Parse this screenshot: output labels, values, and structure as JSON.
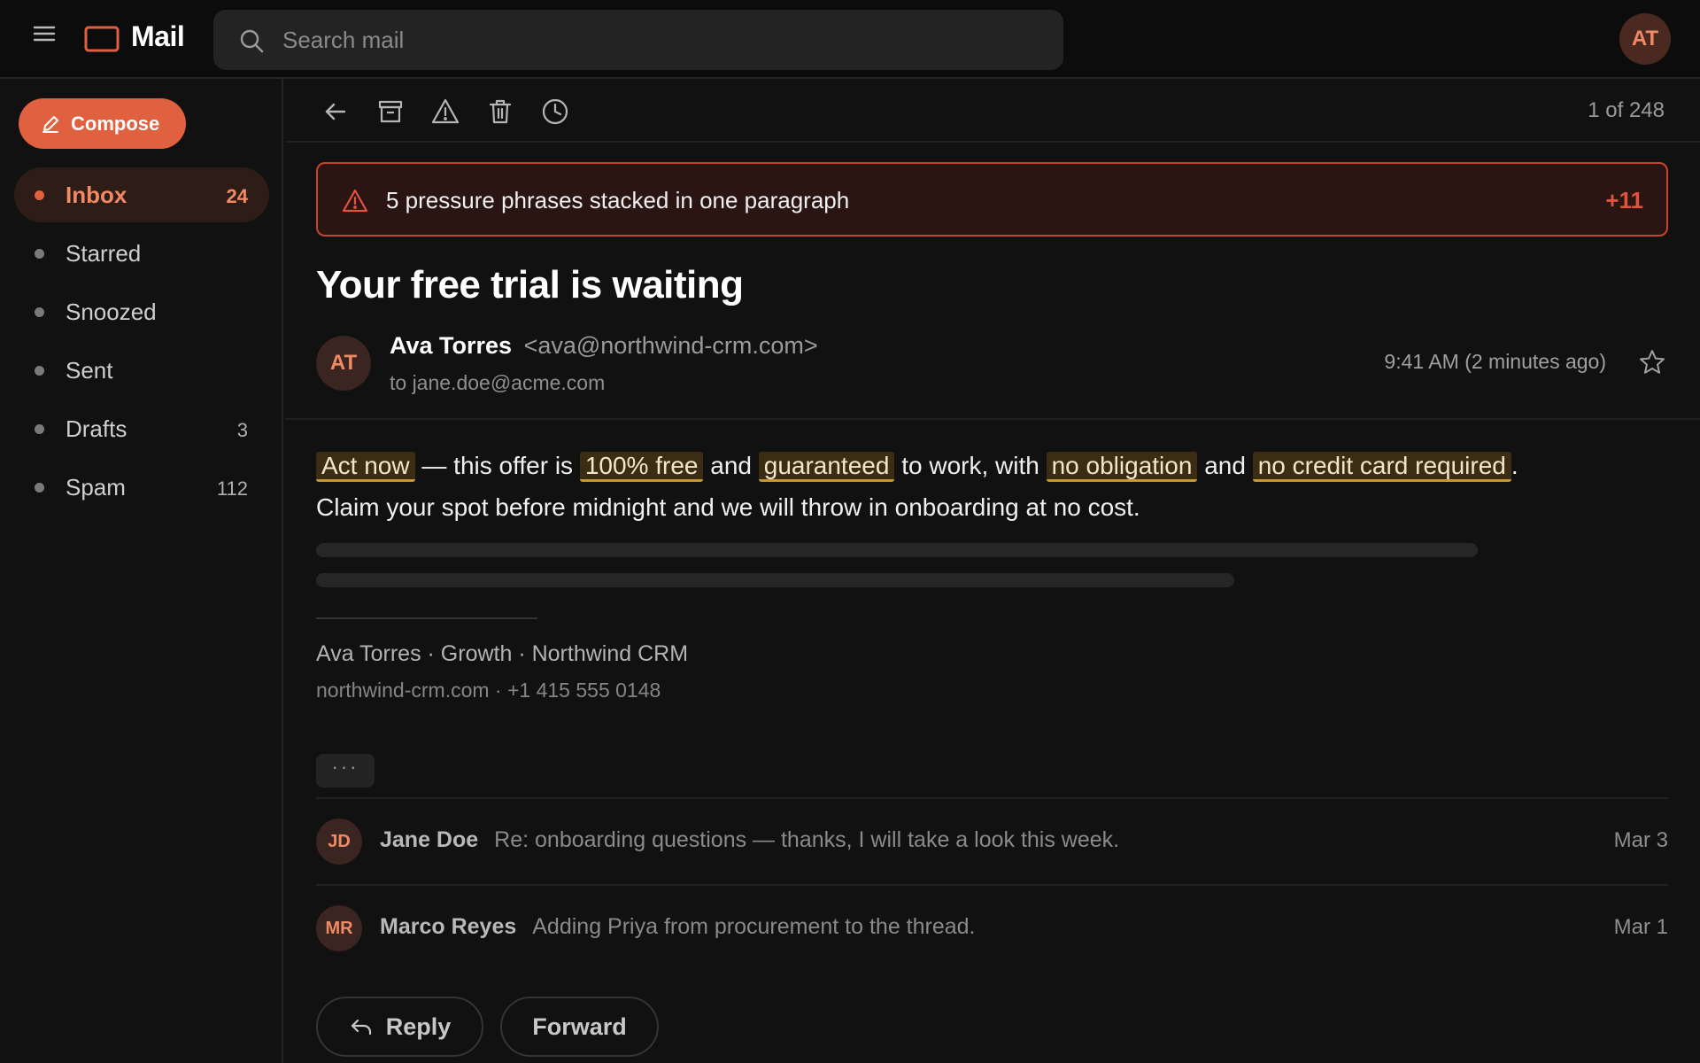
{
  "app": {
    "name": "Mail",
    "accent_color": "#e0613f",
    "user_initials": "AT"
  },
  "search": {
    "placeholder": "Search mail",
    "value": ""
  },
  "sidebar": {
    "compose_label": "Compose",
    "items": [
      {
        "label": "Inbox",
        "count": "24",
        "active": true
      },
      {
        "label": "Starred",
        "count": "",
        "active": false
      },
      {
        "label": "Snoozed",
        "count": "",
        "active": false
      },
      {
        "label": "Sent",
        "count": "",
        "active": false
      },
      {
        "label": "Drafts",
        "count": "3",
        "active": false
      },
      {
        "label": "Spam",
        "count": "112",
        "active": false
      }
    ]
  },
  "toolbar": {
    "icons": [
      "back-arrow-icon",
      "archive-icon",
      "report-spam-icon",
      "delete-icon",
      "snooze-clock-icon"
    ],
    "pager": "1 of 248"
  },
  "alert": {
    "text": "5 pressure phrases stacked in one paragraph",
    "score": "+11",
    "color": "#e0533d"
  },
  "email": {
    "subject": "Your free trial is waiting",
    "sender_initials": "AT",
    "sender_name": "Ava Torres",
    "sender_email": "<ava@northwind-crm.com>",
    "to": "to jane.doe@acme.com",
    "timestamp": "9:41 AM (2 minutes ago)",
    "body": {
      "p1": "Act now",
      "p2": " — this offer is ",
      "p3": "100% free",
      "p4": " and ",
      "p5": "guaranteed",
      "p6": " to work, with ",
      "p7": "no obligation",
      "p8": " and ",
      "p9": "no credit card required",
      "p10": ". Claim your spot before midnight and we will throw in onboarding at no cost."
    },
    "signature_line1": "Ava Torres · Growth · Northwind CRM",
    "signature_line2": "northwind-crm.com · +1 415 555 0148",
    "highlight_color": "#c9962f"
  },
  "thread": {
    "expand_label": "···",
    "messages": [
      {
        "initials": "JD",
        "name": "Jane Doe",
        "snippet": "Re: onboarding questions — thanks, I will take a look this week.",
        "date": "Mar 3"
      },
      {
        "initials": "MR",
        "name": "Marco Reyes",
        "snippet": "Adding Priya from procurement to the thread.",
        "date": "Mar 1"
      }
    ]
  },
  "actions": {
    "reply_label": "Reply",
    "forward_label": "Forward"
  }
}
